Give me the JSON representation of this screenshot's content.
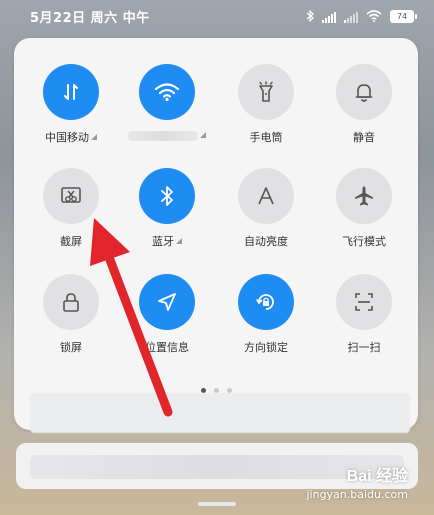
{
  "status_bar": {
    "datetime": "5月22日 周六 中午",
    "battery": "74"
  },
  "tiles": [
    {
      "label": "中国移动",
      "state": "on",
      "icon": "mobile-data-icon",
      "has_menu": true
    },
    {
      "label": "",
      "state": "on",
      "icon": "wifi-icon",
      "has_menu": false,
      "label_obscured": true
    },
    {
      "label": "手电筒",
      "state": "off",
      "icon": "flashlight-icon",
      "has_menu": false
    },
    {
      "label": "静音",
      "state": "off",
      "icon": "bell-icon",
      "has_menu": false
    },
    {
      "label": "截屏",
      "state": "off",
      "icon": "screenshot-icon",
      "has_menu": false
    },
    {
      "label": "蓝牙",
      "state": "on",
      "icon": "bluetooth-icon",
      "has_menu": true
    },
    {
      "label": "自动亮度",
      "state": "off",
      "icon": "auto-brightness-icon",
      "has_menu": false
    },
    {
      "label": "飞行模式",
      "state": "off",
      "icon": "airplane-icon",
      "has_menu": false
    },
    {
      "label": "锁屏",
      "state": "off",
      "icon": "lock-icon",
      "has_menu": false
    },
    {
      "label": "位置信息",
      "state": "on",
      "icon": "location-icon",
      "has_menu": false
    },
    {
      "label": "方向锁定",
      "state": "on",
      "icon": "rotation-lock-icon",
      "has_menu": false
    },
    {
      "label": "扫一扫",
      "state": "off",
      "icon": "scan-icon",
      "has_menu": false
    }
  ],
  "page_indicator": {
    "total": 3,
    "current": 1
  },
  "colors": {
    "active": "#1e8cf2",
    "inactive": "#e1e1e3",
    "annotation_arrow": "#e0262b"
  },
  "watermark": {
    "logo": "Bai 经验",
    "url": "jingyan.baidu.com"
  }
}
